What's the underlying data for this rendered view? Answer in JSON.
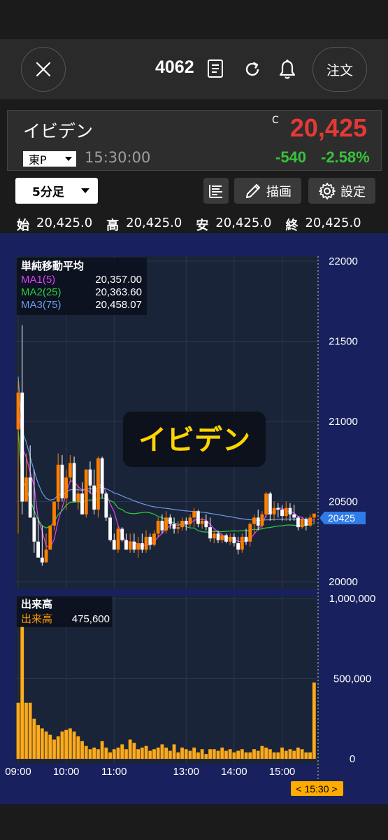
{
  "header": {
    "code": "4062",
    "order_label": "注文"
  },
  "quote": {
    "name": "イビデン",
    "c_mark": "C",
    "price": "20,425",
    "market": "東P",
    "time": "15:30:00",
    "change": "-540",
    "change_pct": "-2.58%"
  },
  "toolbar": {
    "timeframe": "5分足",
    "draw_label": "描画",
    "settings_label": "設定"
  },
  "ohlc": {
    "open_label": "始",
    "open": "20,425.0",
    "high_label": "高",
    "high": "20,425.0",
    "low_label": "安",
    "low": "20,425.0",
    "close_label": "終",
    "close": "20,425.0"
  },
  "chart_data": {
    "type": "candlestick",
    "watermark": "イビデン",
    "ma_legend": {
      "title": "単純移動平均",
      "items": [
        {
          "name": "MA1(5)",
          "value": "20,357.00",
          "color": "#e040fb"
        },
        {
          "name": "MA2(25)",
          "value": "20,363.60",
          "color": "#2ecc40"
        },
        {
          "name": "MA3(75)",
          "value": "20,458.07",
          "color": "#6b9be8"
        }
      ]
    },
    "price_ticks": [
      "22000",
      "21500",
      "21000",
      "20500",
      "20000"
    ],
    "price_range": [
      20000,
      22000
    ],
    "current_price_label": "20425",
    "volume_legend": {
      "title": "出来高",
      "name": "出来高",
      "value": "475,600"
    },
    "volume_ticks": [
      "1,000,000",
      "500,000",
      "0"
    ],
    "volume_range": [
      0,
      1000000
    ],
    "time_ticks": [
      "09:00",
      "10:00",
      "11:00",
      "13:00",
      "14:00",
      "15:00"
    ],
    "cursor_time": "< 15:30 >",
    "up_color": "#ff7f00",
    "down_color": "#ffffff",
    "candles": [
      [
        20950,
        21250,
        20300,
        21180
      ],
      [
        21180,
        21600,
        20420,
        20500
      ],
      [
        20500,
        20800,
        20650,
        20650
      ],
      [
        20650,
        20850,
        20400,
        20400
      ],
      [
        20400,
        20700,
        20180,
        20250
      ],
      [
        20250,
        20400,
        20150,
        20150
      ],
      [
        20150,
        20350,
        20100,
        20120
      ],
      [
        20120,
        20300,
        20150,
        20200
      ],
      [
        20200,
        20350,
        20200,
        20350
      ],
      [
        20350,
        20500,
        20320,
        20500
      ],
      [
        20500,
        20800,
        20450,
        20730
      ],
      [
        20730,
        20790,
        20500,
        20520
      ],
      [
        20520,
        20700,
        20450,
        20650
      ],
      [
        20650,
        20790,
        20620,
        20740
      ],
      [
        20740,
        20780,
        20500,
        20500
      ],
      [
        20500,
        20600,
        20450,
        20550
      ],
      [
        20550,
        20620,
        20420,
        20420
      ],
      [
        20420,
        20700,
        20400,
        20700
      ],
      [
        20700,
        20750,
        20550,
        20600
      ],
      [
        20600,
        20700,
        20420,
        20450
      ],
      [
        20450,
        20780,
        20400,
        20770
      ],
      [
        20770,
        20780,
        20520,
        20550
      ],
      [
        20550,
        20560,
        20380,
        20400
      ],
      [
        20400,
        20420,
        20250,
        20260
      ],
      [
        20260,
        20300,
        20200,
        20200
      ],
      [
        20200,
        20350,
        20180,
        20330
      ],
      [
        20330,
        20340,
        20250,
        20260
      ],
      [
        20260,
        20300,
        20200,
        20200
      ],
      [
        20200,
        20300,
        20180,
        20250
      ],
      [
        20250,
        20300,
        20180,
        20200
      ],
      [
        20200,
        20280,
        20150,
        20240
      ],
      [
        20240,
        20300,
        20180,
        20200
      ],
      [
        20200,
        20320,
        20180,
        20280
      ],
      [
        20280,
        20300,
        20200,
        20230
      ],
      [
        20230,
        20320,
        20220,
        20300
      ],
      [
        20300,
        20400,
        20280,
        20380
      ],
      [
        20380,
        20420,
        20300,
        20320
      ],
      [
        20320,
        20440,
        20300,
        20400
      ],
      [
        20400,
        20420,
        20330,
        20360
      ],
      [
        20360,
        20400,
        20300,
        20330
      ],
      [
        20330,
        20380,
        20300,
        20340
      ],
      [
        20340,
        20400,
        20320,
        20380
      ],
      [
        20380,
        20400,
        20320,
        20360
      ],
      [
        20360,
        20420,
        20340,
        20400
      ],
      [
        20400,
        20460,
        20340,
        20440
      ],
      [
        20440,
        20450,
        20340,
        20360
      ],
      [
        20360,
        20400,
        20330,
        20380
      ],
      [
        20380,
        20420,
        20320,
        20340
      ],
      [
        20340,
        20400,
        20250,
        20270
      ],
      [
        20270,
        20320,
        20240,
        20300
      ],
      [
        20300,
        20320,
        20240,
        20260
      ],
      [
        20260,
        20300,
        20240,
        20290
      ],
      [
        20290,
        20300,
        20240,
        20250
      ],
      [
        20250,
        20300,
        20230,
        20280
      ],
      [
        20280,
        20300,
        20220,
        20240
      ],
      [
        20240,
        20280,
        20170,
        20200
      ],
      [
        20200,
        20300,
        20180,
        20280
      ],
      [
        20280,
        20330,
        20230,
        20250
      ],
      [
        20250,
        20370,
        20220,
        20360
      ],
      [
        20360,
        20420,
        20300,
        20400
      ],
      [
        20400,
        20450,
        20320,
        20350
      ],
      [
        20350,
        20440,
        20330,
        20420
      ],
      [
        20420,
        20560,
        20400,
        20550
      ],
      [
        20550,
        20560,
        20380,
        20420
      ],
      [
        20420,
        20500,
        20380,
        20460
      ],
      [
        20460,
        20490,
        20400,
        20450
      ],
      [
        20450,
        20480,
        20380,
        20410
      ],
      [
        20410,
        20500,
        20380,
        20460
      ],
      [
        20460,
        20490,
        20380,
        20420
      ],
      [
        20420,
        20480,
        20380,
        20400
      ],
      [
        20400,
        20410,
        20320,
        20340
      ],
      [
        20340,
        20400,
        20330,
        20390
      ],
      [
        20390,
        20400,
        20320,
        20350
      ],
      [
        20350,
        20420,
        20340,
        20400
      ],
      [
        20400,
        20425,
        20360,
        20425
      ]
    ],
    "volumes": [
      350000,
      830000,
      350000,
      350000,
      250000,
      210000,
      190000,
      170000,
      150000,
      120000,
      140000,
      170000,
      180000,
      190000,
      170000,
      140000,
      110000,
      80000,
      60000,
      70000,
      60000,
      110000,
      70000,
      40000,
      60000,
      70000,
      90000,
      60000,
      120000,
      100000,
      60000,
      70000,
      80000,
      50000,
      60000,
      70000,
      90000,
      70000,
      50000,
      90000,
      40000,
      70000,
      60000,
      50000,
      70000,
      40000,
      60000,
      30000,
      60000,
      60000,
      50000,
      70000,
      50000,
      60000,
      40000,
      50000,
      60000,
      40000,
      40000,
      60000,
      50000,
      80000,
      70000,
      60000,
      40000,
      40000,
      70000,
      50000,
      60000,
      50000,
      70000,
      60000,
      40000,
      40000,
      475600
    ]
  }
}
